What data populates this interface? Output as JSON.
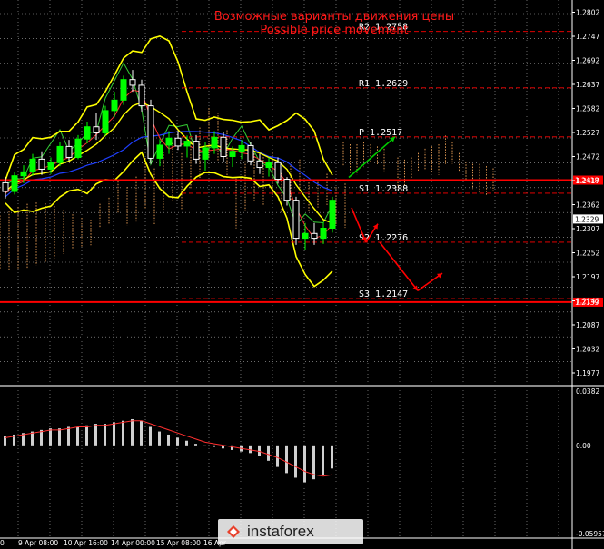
{
  "chart_data": {
    "type": "line",
    "title": "Возможные варианты движения цены",
    "subtitle": "Possible price movement",
    "price_axis": {
      "ticks": [
        "1.2802",
        "1.2747",
        "1.2692",
        "1.2637",
        "1.2582",
        "1.2527",
        "1.2472",
        "1.2417",
        "1.2362",
        "1.2307",
        "1.2252",
        "1.2197",
        "1.2142",
        "1.2087",
        "1.2032",
        "1.1977"
      ],
      "range": [
        1.195,
        1.283
      ]
    },
    "macd_axis": {
      "ticks": [
        "0.0382",
        "0.00",
        "-0.05957"
      ],
      "range": [
        -0.0596,
        0.0382
      ]
    },
    "time_labels": [
      "0",
      "9 Apr 08:00",
      "10 Apr 16:00",
      "14 Apr 00:00",
      "15 Apr 08:00",
      "16 Apr"
    ],
    "levels": [
      {
        "name": "R2",
        "value": "1.2758",
        "price": 1.2758,
        "style": "dashed"
      },
      {
        "name": "R1",
        "value": "1.2629",
        "price": 1.2629,
        "style": "dashed"
      },
      {
        "name": "P",
        "value": "1.2517",
        "price": 1.2517,
        "style": "dashed"
      },
      {
        "name": "S1",
        "value": "1.2388",
        "price": 1.2388,
        "style": "dashed"
      },
      {
        "name": "S2",
        "value": "1.2276",
        "price": 1.2276,
        "style": "dashed"
      },
      {
        "name": "S3",
        "value": "1.2147",
        "price": 1.2147,
        "style": "dashed"
      }
    ],
    "support_resistance": [
      {
        "label": "1.2418",
        "price": 1.2418
      },
      {
        "label": "1.2139",
        "price": 1.2139
      }
    ],
    "current_price": "1.2329",
    "candles": [
      [
        1.2412,
        1.2425,
        1.2376,
        1.2392
      ],
      [
        1.2392,
        1.2437,
        1.2385,
        1.2428
      ],
      [
        1.2428,
        1.2452,
        1.2411,
        1.2437
      ],
      [
        1.2437,
        1.2478,
        1.2428,
        1.2466
      ],
      [
        1.2466,
        1.2484,
        1.243,
        1.2443
      ],
      [
        1.2443,
        1.247,
        1.2432,
        1.2458
      ],
      [
        1.2458,
        1.2505,
        1.245,
        1.2495
      ],
      [
        1.2495,
        1.251,
        1.2462,
        1.247
      ],
      [
        1.247,
        1.2521,
        1.2466,
        1.2512
      ],
      [
        1.2512,
        1.2552,
        1.2502,
        1.254
      ],
      [
        1.254,
        1.2572,
        1.251,
        1.2526
      ],
      [
        1.2526,
        1.2588,
        1.2519,
        1.2577
      ],
      [
        1.2577,
        1.262,
        1.2562,
        1.2601
      ],
      [
        1.2601,
        1.2657,
        1.259,
        1.2648
      ],
      [
        1.2648,
        1.267,
        1.262,
        1.2635
      ],
      [
        1.2635,
        1.2648,
        1.2575,
        1.2588
      ],
      [
        1.2588,
        1.2602,
        1.2455,
        1.2468
      ],
      [
        1.2468,
        1.2512,
        1.245,
        1.2498
      ],
      [
        1.2498,
        1.253,
        1.2478,
        1.2514
      ],
      [
        1.2514,
        1.253,
        1.2487,
        1.2496
      ],
      [
        1.2496,
        1.252,
        1.247,
        1.2507
      ],
      [
        1.2507,
        1.2521,
        1.2455,
        1.2466
      ],
      [
        1.2466,
        1.2505,
        1.244,
        1.2492
      ],
      [
        1.2492,
        1.253,
        1.2478,
        1.2516
      ],
      [
        1.2516,
        1.2528,
        1.246,
        1.2472
      ],
      [
        1.2472,
        1.2495,
        1.2448,
        1.2484
      ],
      [
        1.2484,
        1.251,
        1.2466,
        1.2497
      ],
      [
        1.2497,
        1.2505,
        1.2452,
        1.2462
      ],
      [
        1.2462,
        1.2478,
        1.2432,
        1.2447
      ],
      [
        1.2447,
        1.247,
        1.2426,
        1.2458
      ],
      [
        1.2458,
        1.247,
        1.241,
        1.242
      ],
      [
        1.242,
        1.2425,
        1.236,
        1.2372
      ],
      [
        1.2372,
        1.238,
        1.227,
        1.2285
      ],
      [
        1.2285,
        1.232,
        1.2258,
        1.2296
      ],
      [
        1.2296,
        1.232,
        1.227,
        1.2285
      ],
      [
        1.2285,
        1.2322,
        1.2272,
        1.2308
      ],
      [
        1.2308,
        1.238,
        1.2298,
        1.2372
      ]
    ],
    "macd_hist": [
      0.006,
      0.007,
      0.008,
      0.009,
      0.01,
      0.011,
      0.011,
      0.012,
      0.012,
      0.013,
      0.014,
      0.014,
      0.015,
      0.016,
      0.017,
      0.016,
      0.012,
      0.009,
      0.007,
      0.005,
      0.003,
      0.001,
      0.0,
      -0.001,
      -0.002,
      -0.003,
      -0.004,
      -0.005,
      -0.007,
      -0.01,
      -0.014,
      -0.018,
      -0.021,
      -0.024,
      -0.022,
      -0.019,
      -0.015
    ],
    "macd_signal": [
      0.005,
      0.006,
      0.007,
      0.008,
      0.009,
      0.01,
      0.01,
      0.011,
      0.012,
      0.012,
      0.013,
      0.013,
      0.014,
      0.015,
      0.016,
      0.016,
      0.014,
      0.012,
      0.01,
      0.008,
      0.006,
      0.004,
      0.002,
      0.001,
      0.0,
      -0.001,
      -0.002,
      -0.003,
      -0.004,
      -0.006,
      -0.008,
      -0.011,
      -0.014,
      -0.017,
      -0.019,
      -0.02,
      -0.019
    ],
    "colors": {
      "background": "#000000",
      "bull": "#00ff00",
      "bear": "#ffffff",
      "bollinger": "#ffff00",
      "level": "#ff0000",
      "ema_slow": "#1f3fff",
      "ema_fast": "#ff3030",
      "tenkan": "#33cc33",
      "kumo": "#f2a65a",
      "forecast_up": "#00cc00",
      "forecast_down": "#ff0000",
      "grid": "#b0b0b0"
    }
  },
  "footer": {
    "brand": "instaforex"
  }
}
